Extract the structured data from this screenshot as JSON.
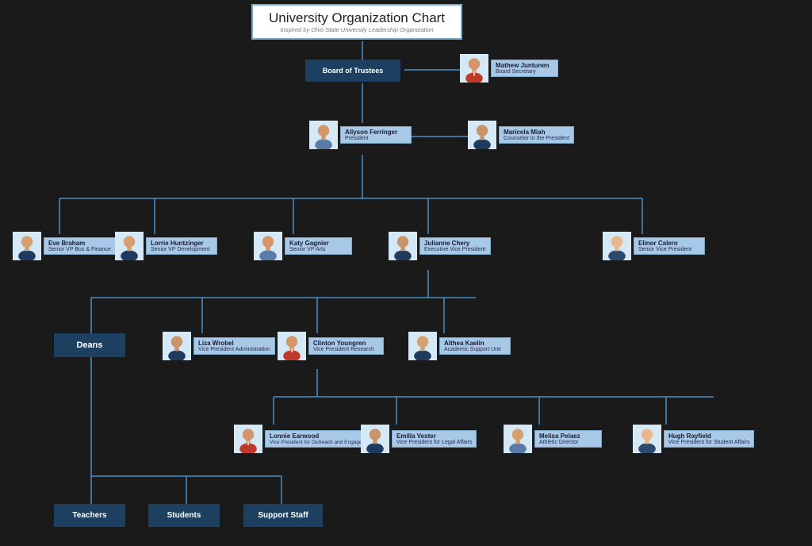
{
  "chart": {
    "title": "University Organization Chart",
    "subtitle": "Inspired by Ohio State University Leadership Organization"
  },
  "nodes": {
    "title_box": {
      "label": "University Organization Chart",
      "sublabel": "Inspired by Ohio State University Leadership Organization"
    },
    "board": {
      "name": "Board of Trustees"
    },
    "mathew": {
      "name": "Mathew Juntunen",
      "title": "Board Secretary"
    },
    "allyson": {
      "name": "Allyson Ferringer",
      "title": "President"
    },
    "maricela": {
      "name": "Maricela Miah",
      "title": "Counselor to the President"
    },
    "eve": {
      "name": "Eve Braham",
      "title": "Senior VP Bus & Finance"
    },
    "lorrie": {
      "name": "Lorrie Huntzinger",
      "title": "Senior VP Development"
    },
    "katy": {
      "name": "Katy Gagnier",
      "title": "Senior VP Arts"
    },
    "julianne": {
      "name": "Julianne Chery",
      "title": "Executive Vice President"
    },
    "elinor": {
      "name": "Elinor Calero",
      "title": "Senior Vice President"
    },
    "deans": {
      "name": "Deans"
    },
    "liza": {
      "name": "Liza Wrobel",
      "title": "Vice President Administration"
    },
    "clinton": {
      "name": "Clinton Youngren",
      "title": "Vice President Research"
    },
    "althea": {
      "name": "Althea Kaelin",
      "title": "Academic Support Unit"
    },
    "lonnie": {
      "name": "Lonnie Earwood",
      "title": "Vice President for Outreach and Engagement"
    },
    "emilla": {
      "name": "Emilla Vester",
      "title": "Vice President for Legal Affairs"
    },
    "melisa": {
      "name": "Melisa Pelaez",
      "title": "Athletic Director"
    },
    "hugh": {
      "name": "Hugh Rayfield",
      "title": "Vice President for Student Affairs"
    },
    "teachers": {
      "name": "Teachers"
    },
    "students": {
      "name": "Students"
    },
    "support": {
      "name": "Support Staff"
    }
  }
}
